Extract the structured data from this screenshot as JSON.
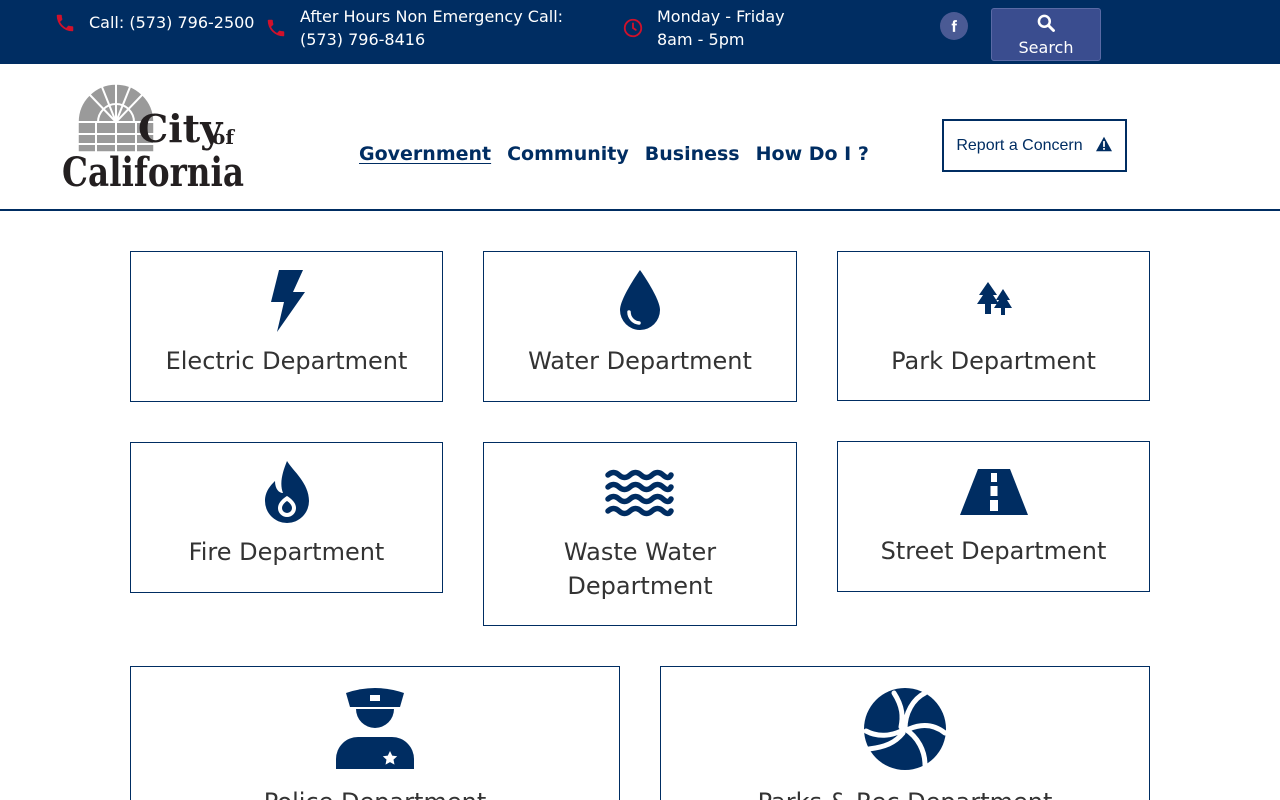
{
  "topbar": {
    "call": "Call: (573) 796-2500",
    "after_hours_line1": "After Hours Non Emergency Call:",
    "after_hours_line2": "(573) 796-8416",
    "hours_line1": "Monday - Friday",
    "hours_line2": "8am - 5pm",
    "search_label": "Search"
  },
  "logo": {
    "line1": "City of",
    "line2": "California"
  },
  "nav": {
    "items": [
      "Government",
      "Community",
      "Business",
      "How Do I ?"
    ]
  },
  "report_concern": "Report a Concern",
  "departments": [
    {
      "name": "Electric Department",
      "icon": "lightning-bolt-icon"
    },
    {
      "name": "Water Department",
      "icon": "water-drop-icon"
    },
    {
      "name": "Park Department",
      "icon": "trees-icon"
    },
    {
      "name": "Fire Department",
      "icon": "flame-icon"
    },
    {
      "name": "Waste Water Department",
      "icon": "water-waves-icon"
    },
    {
      "name": "Street Department",
      "icon": "road-icon"
    },
    {
      "name": "Police Department",
      "icon": "police-officer-icon"
    },
    {
      "name": "Parks & Rec Department",
      "icon": "volleyball-icon"
    }
  ],
  "colors": {
    "brand_navy": "#002d62",
    "accent_red": "#c8102e",
    "text": "#333333"
  }
}
